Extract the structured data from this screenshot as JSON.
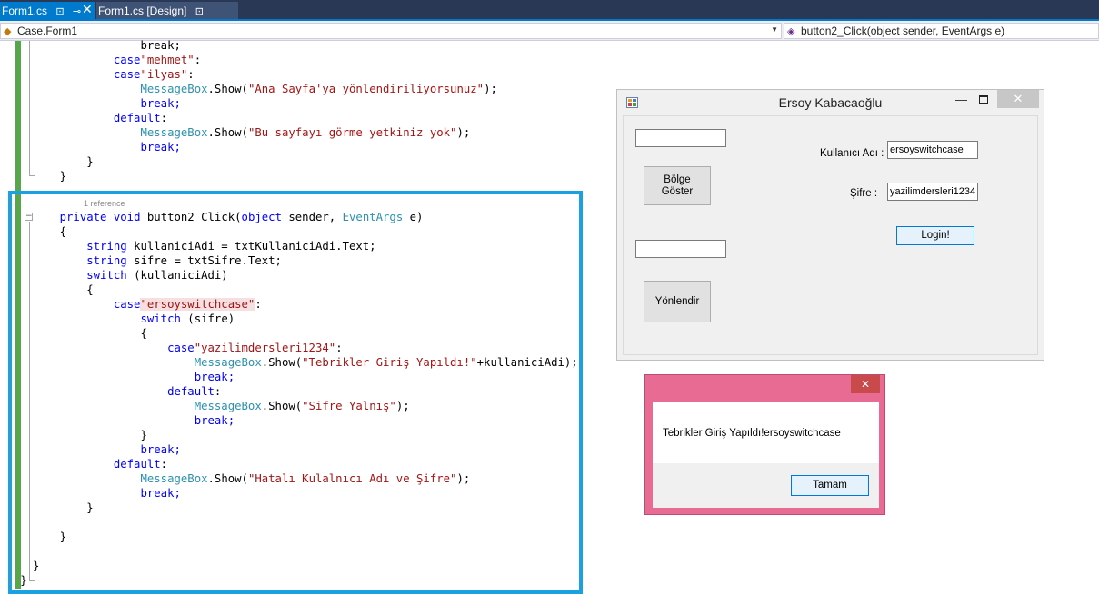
{
  "tabs": [
    {
      "label": "Form1.cs",
      "pin": "⊡",
      "pin2": "⊸"
    },
    {
      "label": "Form1.cs [Design]",
      "pin": "⊡"
    }
  ],
  "tab_close": "✕",
  "navbar": {
    "class_selector": "Case.Form1",
    "member_selector": "button2_Click(object sender, EventArgs e)"
  },
  "code": {
    "ref_hint": "1 reference",
    "lines": {
      "l01": "break;",
      "l02_kw": "case",
      "l02_str": "\"mehmet\"",
      "l02_end": ":",
      "l03_kw": "case",
      "l03_str": "\"ilyas\"",
      "l03_end": ":",
      "l04_typ": "MessageBox",
      "l04_mid": ".Show(",
      "l04_str": "\"Ana Sayfa'ya yönlendiriliyorsunuz\"",
      "l04_end": ");",
      "l05": "break;",
      "l06_kw": "default",
      "l06_end": ":",
      "l07_typ": "MessageBox",
      "l07_mid": ".Show(",
      "l07_str": "\"Bu sayfayı görme yetkiniz yok\"",
      "l07_end": ");",
      "l08": "break;",
      "l09": "}",
      "l10": "}",
      "l11_kw1": "private",
      "l11_kw2": "void",
      "l11_mid": "button2_Click(",
      "l11_kw3": "object",
      "l11_mid2": "sender, ",
      "l11_typ": "EventArgs",
      "l11_end": "e)",
      "l12": "{",
      "l13_kw": "string",
      "l13_rest": "kullaniciAdi = txtKullaniciAdi.Text;",
      "l14_kw": "string",
      "l14_rest": "sifre = txtSifre.Text;",
      "l15_kw": "switch",
      "l15_rest": "(kullaniciAdi)",
      "l16": "{",
      "l17_kw": "case",
      "l17_str": "\"ersoyswitchcase\"",
      "l17_end": ":",
      "l18_kw": "switch",
      "l18_rest": "(sifre)",
      "l19": "{",
      "l20_kw": "case",
      "l20_str": "\"yazilimdersleri1234\"",
      "l20_end": ":",
      "l21_typ": "MessageBox",
      "l21_mid": ".Show(",
      "l21_str": "\"Tebrikler Giriş Yapıldı!\"",
      "l21_end": "+kullaniciAdi);",
      "l22": "break;",
      "l23_kw": "default",
      "l23_end": ":",
      "l24_typ": "MessageBox",
      "l24_mid": ".Show(",
      "l24_str": "\"Sifre Yalnış\"",
      "l24_end": ");",
      "l25": "break;",
      "l26": "}",
      "l27": "break;",
      "l28_kw": "default",
      "l28_end": ":",
      "l29_typ": "MessageBox",
      "l29_mid": ".Show(",
      "l29_str": "\"Hatalı Kulalnıcı Adı ve Şifre\"",
      "l29_end": ");",
      "l30": "break;",
      "l31": "}",
      "l32": "}",
      "l33": "}",
      "l34": "}"
    }
  },
  "form": {
    "title": "Ersoy Kabacaoğlu",
    "min": "—",
    "close": "✕",
    "textbox1_value": "",
    "textbox2_value": "",
    "bolge_button": "Bölge\nGöster",
    "yonlendir_button": "Yönlendir",
    "kullanici_label": "Kullanıcı Adı :",
    "kullanici_value": "ersoyswitchcase",
    "sifre_label": "Şifre :",
    "sifre_value": "yazilimdersleri1234",
    "login_button": "Login!"
  },
  "messagebox": {
    "close": "✕",
    "text": "Tebrikler Giriş Yapıldı!ersoyswitchcase",
    "ok_button": "Tamam"
  },
  "colors": {
    "tab_active": "#007acc",
    "highlight_frame": "#1ba1e2",
    "messagebox_border": "#e76b92",
    "change_bar": "#57a64a"
  }
}
